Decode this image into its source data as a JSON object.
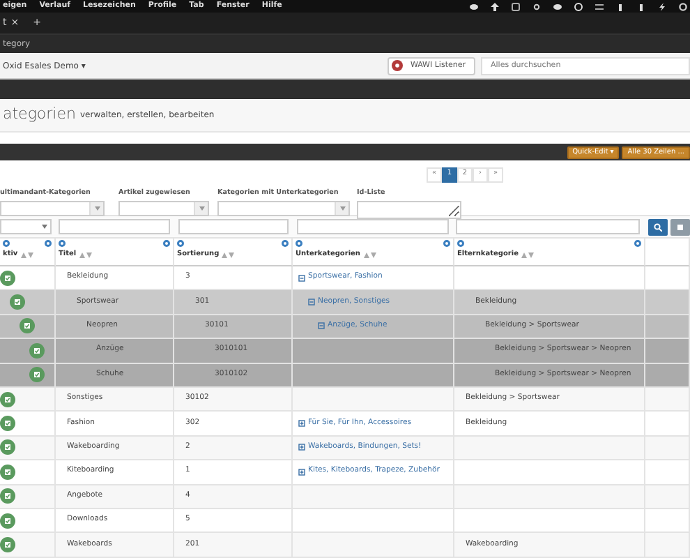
{
  "menu_bar": {
    "items": [
      "eigen",
      "Verlauf",
      "Lesezeichen",
      "Profile",
      "Tab",
      "Fenster",
      "Hilfe"
    ]
  },
  "browser": {
    "tab": {
      "label": "t",
      "close": "×"
    },
    "new_tab": "+",
    "address": "tegory"
  },
  "header": {
    "shop": "Oxid Esales Demo ▾",
    "wawi_button": "WAWI Listener",
    "search": {
      "placeholder": "Alles durchsuchen"
    }
  },
  "page_title": {
    "title": "ategorien",
    "subtitle": "verwalten, erstellen, bearbeiten"
  },
  "toolbar": {
    "buttons": [
      "Quick-Edit ▾",
      "Alle 30 Zeilen ..."
    ]
  },
  "pagination": [
    {
      "label": "«",
      "selected": false
    },
    {
      "label": "1",
      "selected": true
    },
    {
      "label": "2",
      "selected": false
    },
    {
      "label": "›",
      "selected": false
    },
    {
      "label": "»",
      "selected": false
    }
  ],
  "filters": [
    {
      "label": "ultimandant-Kategorien",
      "kind": "select"
    },
    {
      "label": "Artikel zugewiesen",
      "kind": "select"
    },
    {
      "label": "Kategorien mit Unterkategorien",
      "kind": "select"
    },
    {
      "label": "Id-Liste",
      "kind": "textarea"
    }
  ],
  "columns": [
    "ktiv",
    "Titel",
    "Sortierung",
    "Unterkategorien",
    "Elternkategorie"
  ],
  "rows": [
    {
      "active": true,
      "title": "Bekleidung",
      "sort": "3",
      "subcategories": "Sportswear, Fashion",
      "expanded": true,
      "parent": "",
      "children": [
        {
          "active": true,
          "title": "Sportswear",
          "sort": "301",
          "subcategories": "Neopren, Sonstiges",
          "expanded": true,
          "parent": "Bekleidung",
          "children": [
            {
              "active": true,
              "title": "Neopren",
              "sort": "30101",
              "subcategories": "Anzüge, Schuhe",
              "expanded": true,
              "parent": "Bekleidung > Sportswear",
              "children": [
                {
                  "active": true,
                  "title": "Anzüge",
                  "sort": "3010101",
                  "parent": "Bekleidung > Sportswear > Neopren"
                },
                {
                  "active": true,
                  "title": "Schuhe",
                  "sort": "3010102",
                  "parent": "Bekleidung > Sportswear > Neopren"
                }
              ]
            }
          ]
        }
      ]
    },
    {
      "active": true,
      "title": "Sonstiges",
      "sort": "30102",
      "parent": "Bekleidung > Sportswear"
    },
    {
      "active": true,
      "title": "Fashion",
      "sort": "302",
      "subcategories": "Für Sie, Für Ihn, Accessoires",
      "expanded": false,
      "parent": "Bekleidung"
    },
    {
      "active": true,
      "title": "Wakeboarding",
      "sort": "2",
      "subcategories": "Wakeboards, Bindungen, Sets!",
      "expanded": false,
      "parent": ""
    },
    {
      "active": true,
      "title": "Kiteboarding",
      "sort": "1",
      "subcategories": "Kites, Kiteboards, Trapeze, Zubehör",
      "expanded": false,
      "parent": ""
    },
    {
      "active": true,
      "title": "Angebote",
      "sort": "4",
      "parent": ""
    },
    {
      "active": true,
      "title": "Downloads",
      "sort": "5",
      "parent": ""
    },
    {
      "active": true,
      "title": "Wakeboards",
      "sort": "201",
      "parent": "Wakeboarding"
    }
  ]
}
